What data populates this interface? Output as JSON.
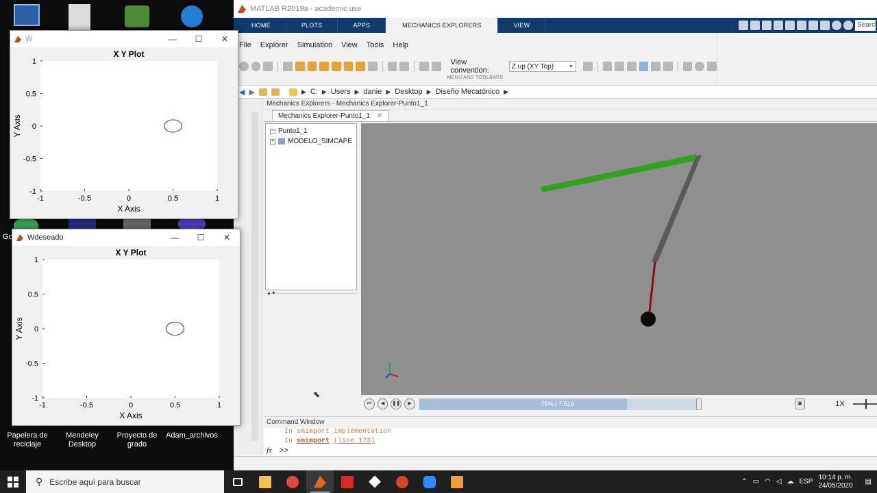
{
  "desktop": {
    "icons": [
      {
        "label": "Papelera de reciclaje"
      },
      {
        "label": "Mendeley Desktop"
      },
      {
        "label": "Proyecto de grado"
      },
      {
        "label": "Adam_archivos"
      }
    ],
    "hidden_label_fragment": "Go"
  },
  "matlab": {
    "title": "MATLAB R2019a - academic use",
    "tabs": [
      "HOME",
      "PLOTS",
      "APPS",
      "MECHANICS EXPLORERS",
      "VIEW"
    ],
    "search_placeholder": "Search",
    "menu": [
      "File",
      "Explorer",
      "Simulation",
      "View",
      "Tools",
      "Help"
    ],
    "view_convention_label": "View convention:",
    "view_convention_value": "Z up (XY Top)",
    "strip_label": "MENU AND TOOLBARS",
    "address": [
      "C:",
      "Users",
      "danie",
      "Desktop",
      "Diseño Mecatónico"
    ],
    "explorer_header": "Mechanics Explorers - Mechanics Explorer-Punto1_1",
    "explorer_tab": "Mechanics Explorer-Punto1_1",
    "tree": [
      {
        "label": "Punto1_1"
      },
      {
        "label": "MODELO_SIMCAPE"
      }
    ],
    "playback": {
      "progress_text": "75% / 7.519",
      "progress_fraction": 0.75,
      "speed": "1X"
    },
    "command_window": {
      "title": "Command Window",
      "line1": "In smimport_implementation",
      "line2_prefix": "In ",
      "line2_func": "smimport",
      "line2_loc": "(line 173)",
      "prompt": ">>",
      "fx": "fx"
    }
  },
  "figures": [
    {
      "title": "W",
      "plot_title": "X Y Plot",
      "xlabel": "X Axis",
      "ylabel": "Y Axis",
      "xticks": [
        "-1",
        "-0.5",
        "0",
        "0.5",
        "1"
      ],
      "yticks": [
        "1",
        "0.5",
        "0",
        "-0.5",
        "-1"
      ]
    },
    {
      "title": "Wdeseado",
      "plot_title": "X Y Plot",
      "xlabel": "X Axis",
      "ylabel": "Y Axis",
      "xticks": [
        "-1",
        "-0.5",
        "0",
        "0.5",
        "1"
      ],
      "yticks": [
        "1",
        "0.5",
        "0",
        "-0.5",
        "-1"
      ]
    }
  ],
  "taskbar": {
    "search_placeholder": "Escribe aquí para buscar",
    "lang": "ESP",
    "time": "10:14 p. m.",
    "date": "24/05/2020"
  },
  "colors": {
    "matlab_tabbar": "#0f3a6b",
    "viewport_bg": "#8f8f8f",
    "green_link": "#2fa31c",
    "gray_link": "#5a5a5a",
    "red_link": "#8a0e0e",
    "plot_line": "#2a2aa8"
  }
}
